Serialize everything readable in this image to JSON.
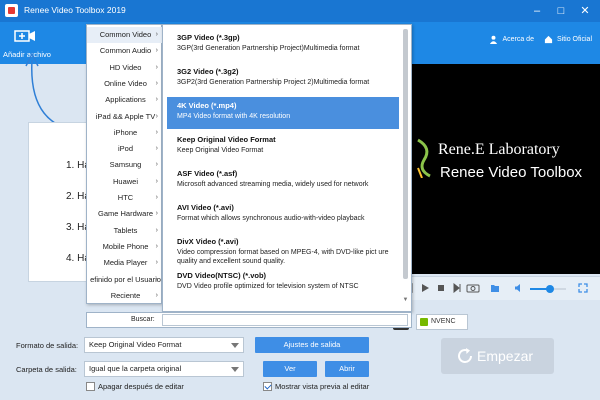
{
  "window": {
    "title": "Renee Video Toolbox 2019"
  },
  "toolbar": {
    "add_file": "Añadir archivo",
    "about": "Acerca de",
    "official_site": "Sitio Oficial"
  },
  "steps": [
    "1. Ha",
    "2. Ha",
    "3. Ha",
    "4. Ha"
  ],
  "preview": {
    "line1": "Rene.E Laboratory",
    "line2": "Renee Video Toolbox"
  },
  "player": {
    "volume_level": 0.55
  },
  "badges": {
    "nvenc": "NVENC"
  },
  "categories": [
    "Common Video",
    "Common Audio",
    "HD Video",
    "Online Video",
    "Applications",
    "iPad && Apple TV",
    "iPhone",
    "iPod",
    "Samsung",
    "Huawei",
    "HTC",
    "Game Hardware",
    "Tablets",
    "Mobile Phone",
    "Media Player",
    "efinido por el Usuario",
    "Reciente"
  ],
  "formats": [
    {
      "name": "3GP Video (*.3gp)",
      "desc": "3GP(3rd Generation Partnership Project)Multimedia format"
    },
    {
      "name": "3G2 Video (*.3g2)",
      "desc": "3GP2(3rd Generation Partnership Project 2)Multimedia format"
    },
    {
      "name": "4K Video (*.mp4)",
      "desc": "MP4 Video format with 4K resolution"
    },
    {
      "name": "Keep Original Video Format",
      "desc": "Keep Original Video Format"
    },
    {
      "name": "ASF Video (*.asf)",
      "desc": "Microsoft advanced streaming media, widely used for network"
    },
    {
      "name": "AVI Video (*.avi)",
      "desc": "Format which allows synchronous audio-with-video playback"
    },
    {
      "name": "DivX Video (*.avi)",
      "desc": "Video compression format based on MPEG-4, with DVD-like pict ure quality and excellent sound quality."
    },
    {
      "name": "DVD Video(NTSC) (*.vob)",
      "desc": "DVD Video profile optimized for television system of NTSC"
    }
  ],
  "search": {
    "label": "Buscar:"
  },
  "form": {
    "output_format_label": "Formato de salida:",
    "output_format_value": "Keep Original Video Format",
    "output_settings": "Ajustes de salida",
    "output_folder_label": "Carpeta de salida:",
    "output_folder_value": "Igual que la carpeta original",
    "view": "Ver",
    "open": "Abrir",
    "shutdown_label": "Apagar después de editar",
    "preview_label": "Mostrar vista previa al editar",
    "start": "Empezar"
  }
}
